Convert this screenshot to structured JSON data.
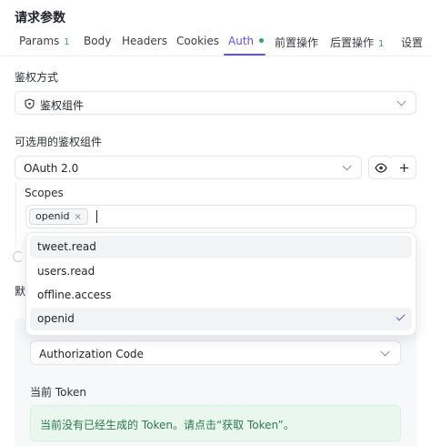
{
  "title": "请求参数",
  "tabs": [
    {
      "label": "Params",
      "count": "1"
    },
    {
      "label": "Body"
    },
    {
      "label": "Headers"
    },
    {
      "label": "Cookies"
    },
    {
      "label": "Auth",
      "active": true
    },
    {
      "label": "前置操作"
    },
    {
      "label": "后置操作",
      "count": "1"
    },
    {
      "label": "设置"
    }
  ],
  "auth_method": {
    "label": "鉴权方式",
    "value": "鉴权组件",
    "icon": "shield-icon"
  },
  "component": {
    "label": "可选用的鉴权组件",
    "value": "OAuth 2.0",
    "view_icon": "eye-icon",
    "add_icon": "plus-icon"
  },
  "scopes": {
    "label": "Scopes",
    "selected": [
      {
        "label": "openid",
        "remove": "×"
      }
    ],
    "options": [
      {
        "label": "tweet.read"
      },
      {
        "label": "users.read"
      },
      {
        "label": "offline.access"
      },
      {
        "label": "openid",
        "selected": true
      }
    ]
  },
  "hidden_label_fragment": "默",
  "grant_type": {
    "value": "Authorization Code"
  },
  "current_token": {
    "label": "当前 Token",
    "message": "当前没有已经生成的 Token。请点击“获取 Token”。"
  },
  "colors": {
    "accent": "#6a4de3",
    "success": "#2fa56b"
  }
}
